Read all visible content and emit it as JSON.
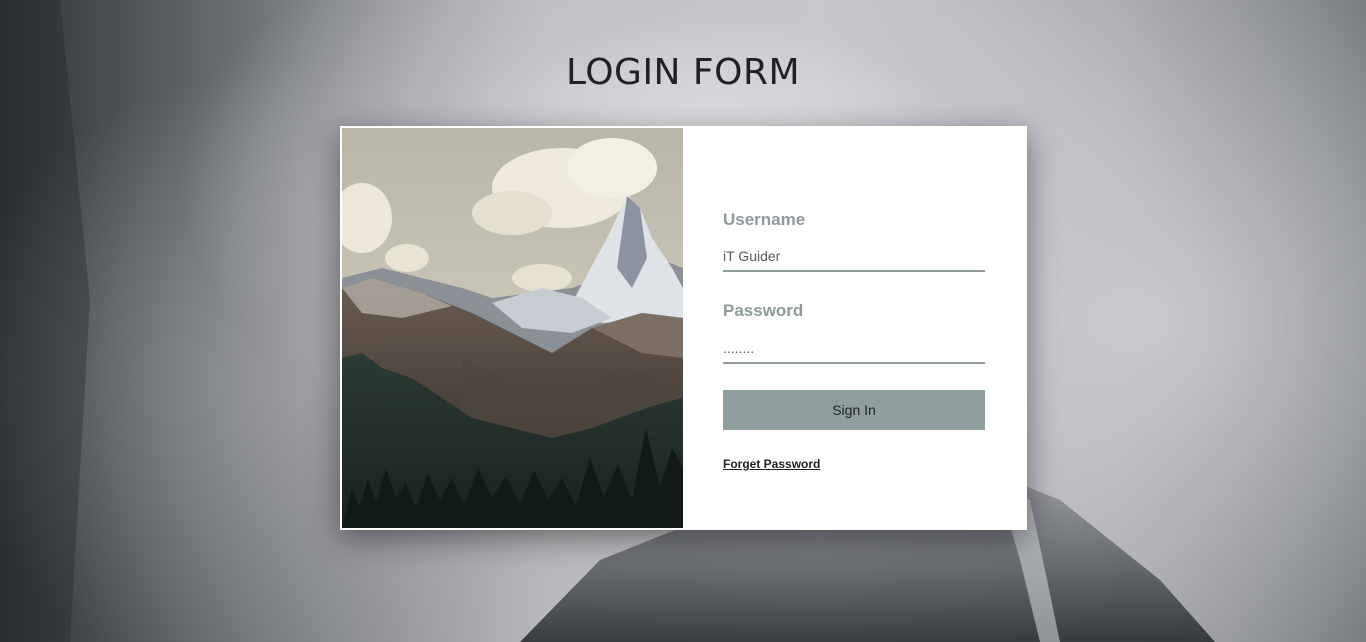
{
  "page": {
    "title": "LOGIN FORM"
  },
  "form": {
    "username_label": "Username",
    "username_value": "iT Guider",
    "password_label": "Password",
    "password_value": "........",
    "signin_label": "Sign In",
    "forget_label": "Forget Password"
  },
  "colors": {
    "accent": "#8f9f9e",
    "label": "#8e9a9b",
    "card_bg": "#ffffff"
  }
}
